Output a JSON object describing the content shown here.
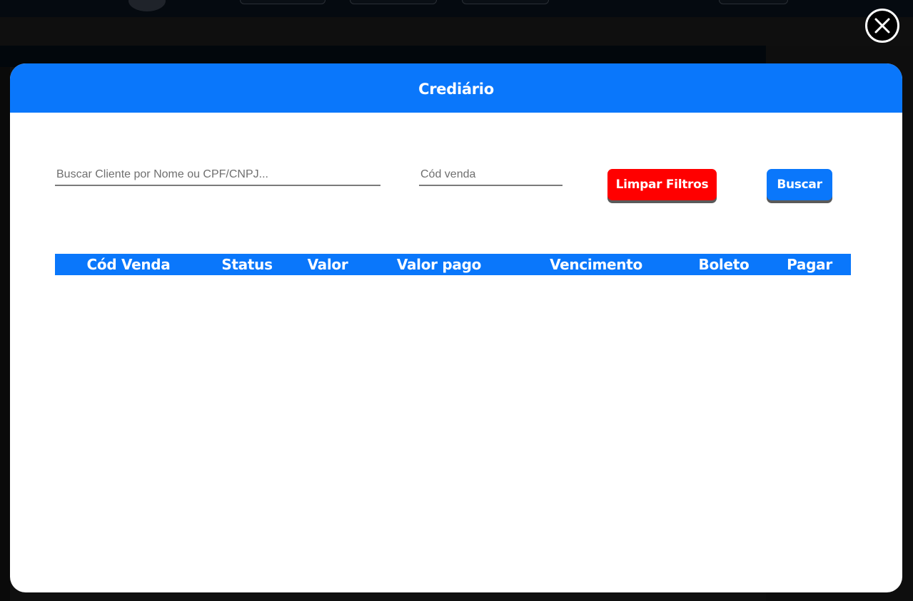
{
  "modal": {
    "title": "Crediário",
    "close_icon": "close-icon"
  },
  "filters": {
    "client_placeholder": "Buscar Cliente por Nome ou CPF/CNPJ...",
    "client_value": "",
    "sale_code_placeholder": "Cód venda",
    "sale_code_value": "",
    "clear_label": "Limpar Filtros",
    "search_label": "Buscar"
  },
  "table": {
    "columns": [
      "Cód Venda",
      "Status",
      "Valor",
      "Valor pago",
      "Vencimento",
      "Boleto",
      "Pagar"
    ],
    "rows": []
  },
  "colors": {
    "primary": "#0a77fb",
    "danger": "#ff0000",
    "overlay": "#101010"
  }
}
